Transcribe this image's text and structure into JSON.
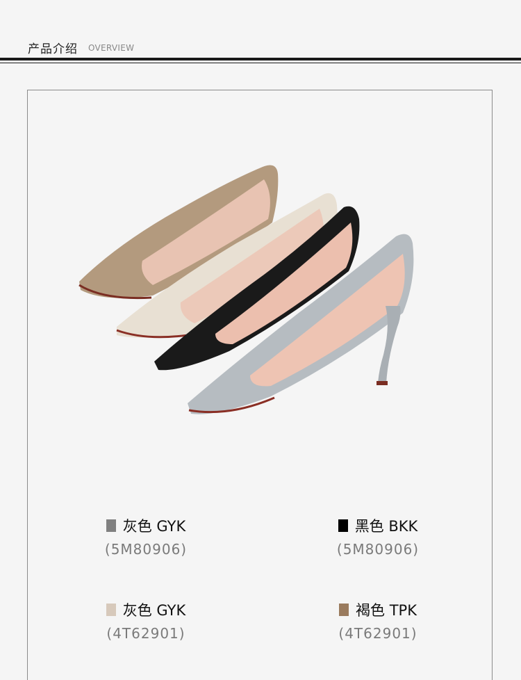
{
  "header": {
    "title": "产品介绍",
    "subtitle": "OVERVIEW"
  },
  "variants": [
    {
      "name": "灰色 GYK",
      "code": "(5M80906)",
      "swatch": "#808080"
    },
    {
      "name": "黑色 BKK",
      "code": "(5M80906)",
      "swatch": "#000000"
    },
    {
      "name": "灰色 GYK",
      "code": "(4T62901)",
      "swatch": "#d7c9bb"
    },
    {
      "name": "褐色 TPK",
      "code": "(4T62901)",
      "swatch": "#9a7b5e"
    }
  ],
  "colors": {
    "shoe_taupe": "#b39a7e",
    "shoe_cream": "#e8e0d3",
    "shoe_black": "#1a1a1a",
    "shoe_grey": "#b6bcc1",
    "lining": "#e9bfae"
  }
}
